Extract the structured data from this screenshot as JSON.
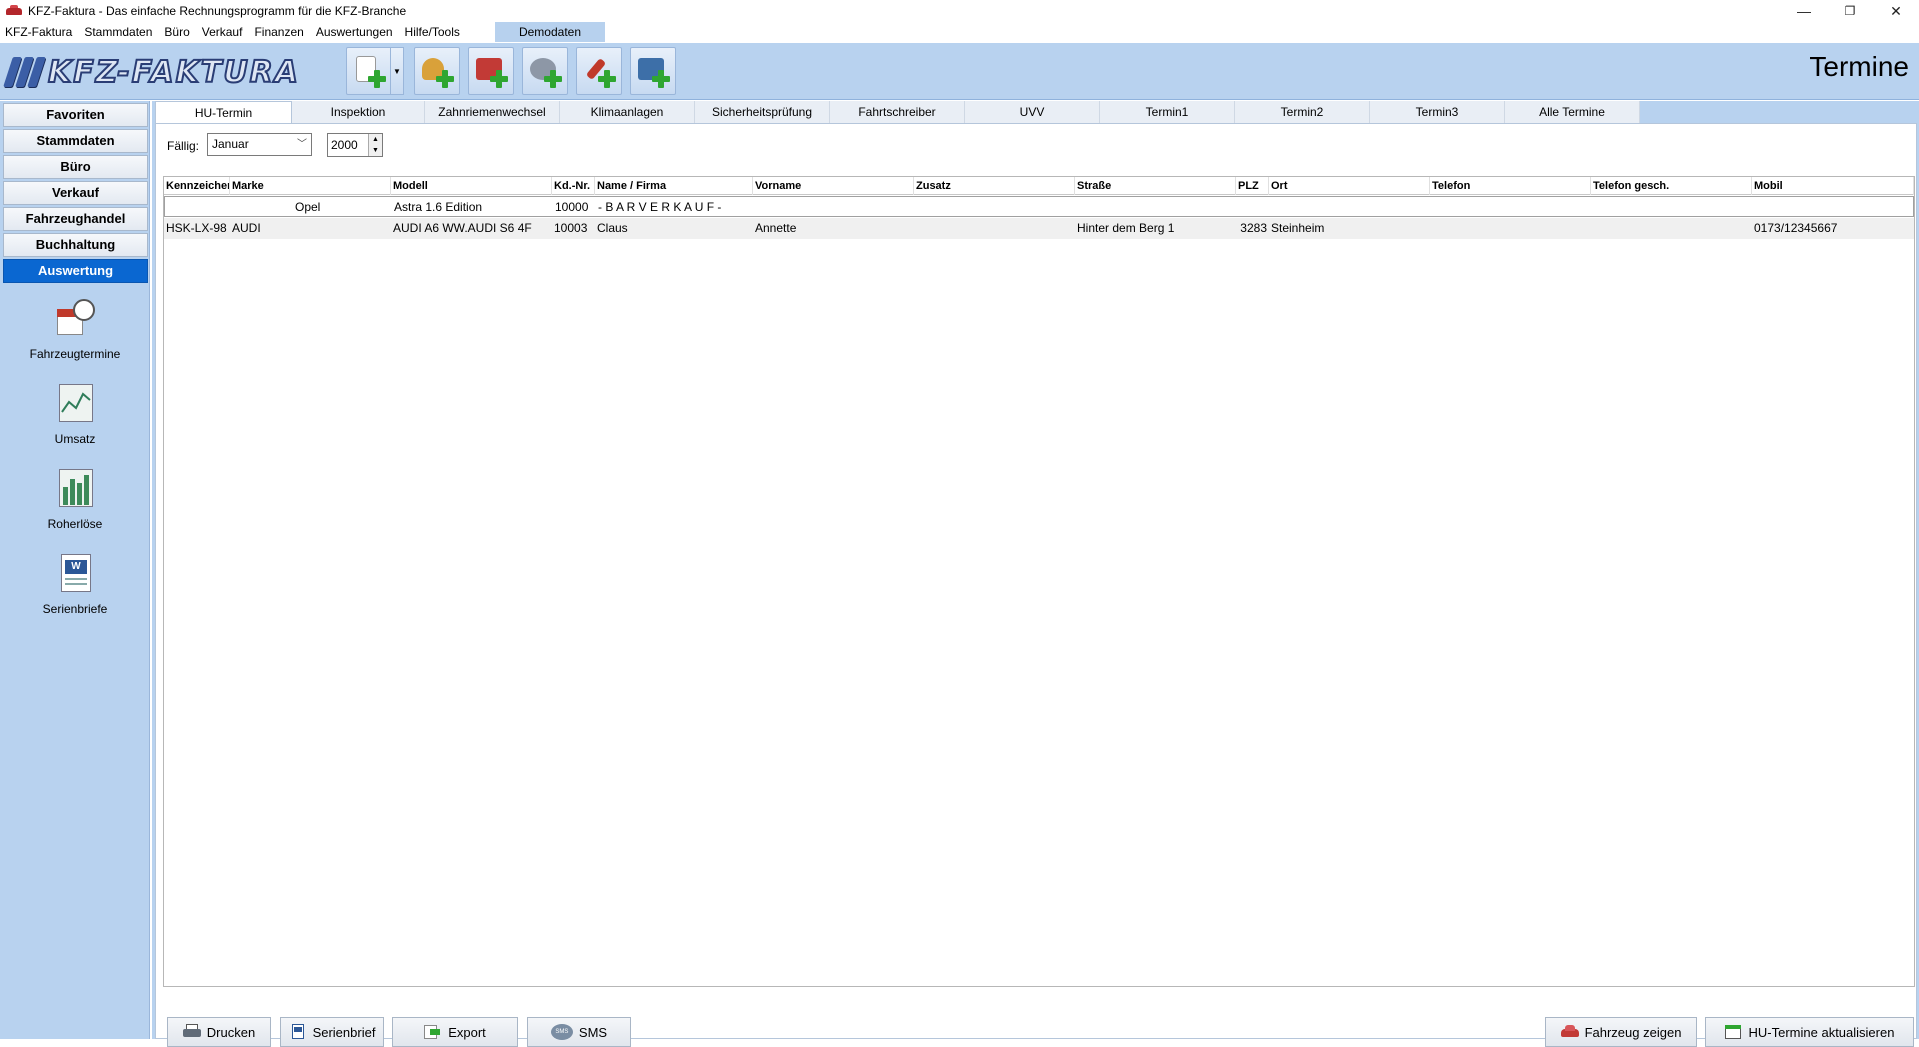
{
  "window": {
    "title": "KFZ-Faktura - Das einfache Rechnungsprogramm für die KFZ-Branche",
    "minimize": "—",
    "restore": "❐",
    "close": "✕"
  },
  "menu": {
    "items": [
      "KFZ-Faktura",
      "Stammdaten",
      "Büro",
      "Verkauf",
      "Finanzen",
      "Auswertungen",
      "Hilfe/Tools"
    ],
    "demodaten": "Demodaten"
  },
  "header": {
    "logo_text": "KFZ-FAKTURA",
    "page_title": "Termine"
  },
  "sidebar": {
    "nav": [
      "Favoriten",
      "Stammdaten",
      "Büro",
      "Verkauf",
      "Fahrzeughandel",
      "Buchhaltung",
      "Auswertung"
    ],
    "active_nav": "Auswertung",
    "items": [
      {
        "label": "Fahrzeugtermine",
        "icon": "calendar-clock-icon"
      },
      {
        "label": "Umsatz",
        "icon": "line-chart-icon"
      },
      {
        "label": "Roherlöse",
        "icon": "bar-chart-icon"
      },
      {
        "label": "Serienbriefe",
        "icon": "word-document-icon"
      }
    ]
  },
  "tabs": [
    "HU-Termin",
    "Inspektion",
    "Zahnriemenwechsel",
    "Klimaanlagen",
    "Sicherheitsprüfung",
    "Fahrtschreiber",
    "UVV",
    "Termin1",
    "Termin2",
    "Termin3",
    "Alle Termine"
  ],
  "active_tab": "HU-Termin",
  "filter": {
    "label": "Fällig:",
    "month": "Januar",
    "year": "2000"
  },
  "table": {
    "columns": [
      "Kennzeichen",
      "Marke",
      "Modell",
      "Kd.-Nr.",
      "Name / Firma",
      "Vorname",
      "Zusatz",
      "Straße",
      "PLZ",
      "Ort",
      "Telefon",
      "Telefon gesch.",
      "Mobil"
    ],
    "rows": [
      [
        "",
        "Opel",
        "Astra 1.6 Edition",
        "10000",
        "- B A R V E R K A U F -",
        "",
        "",
        "",
        "",
        "",
        "",
        "",
        ""
      ],
      [
        "HSK-LX-98",
        "AUDI",
        "AUDI A6 WW.AUDI S6 4F",
        "10003",
        "Claus",
        "Annette",
        "",
        "Hinter dem Berg 1",
        "3283",
        "Steinheim",
        "",
        "",
        "0173/12345667"
      ]
    ]
  },
  "footer": {
    "print": "Drucken",
    "serial_letter": "Serienbrief",
    "export": "Export",
    "sms": "SMS",
    "show_vehicle": "Fahrzeug zeigen",
    "update_hu": "HU-Termine aktualisieren"
  },
  "colors": {
    "accent": "#0a67d1",
    "panel_bg": "#b8d2ef",
    "plus_green": "#2fa631"
  }
}
